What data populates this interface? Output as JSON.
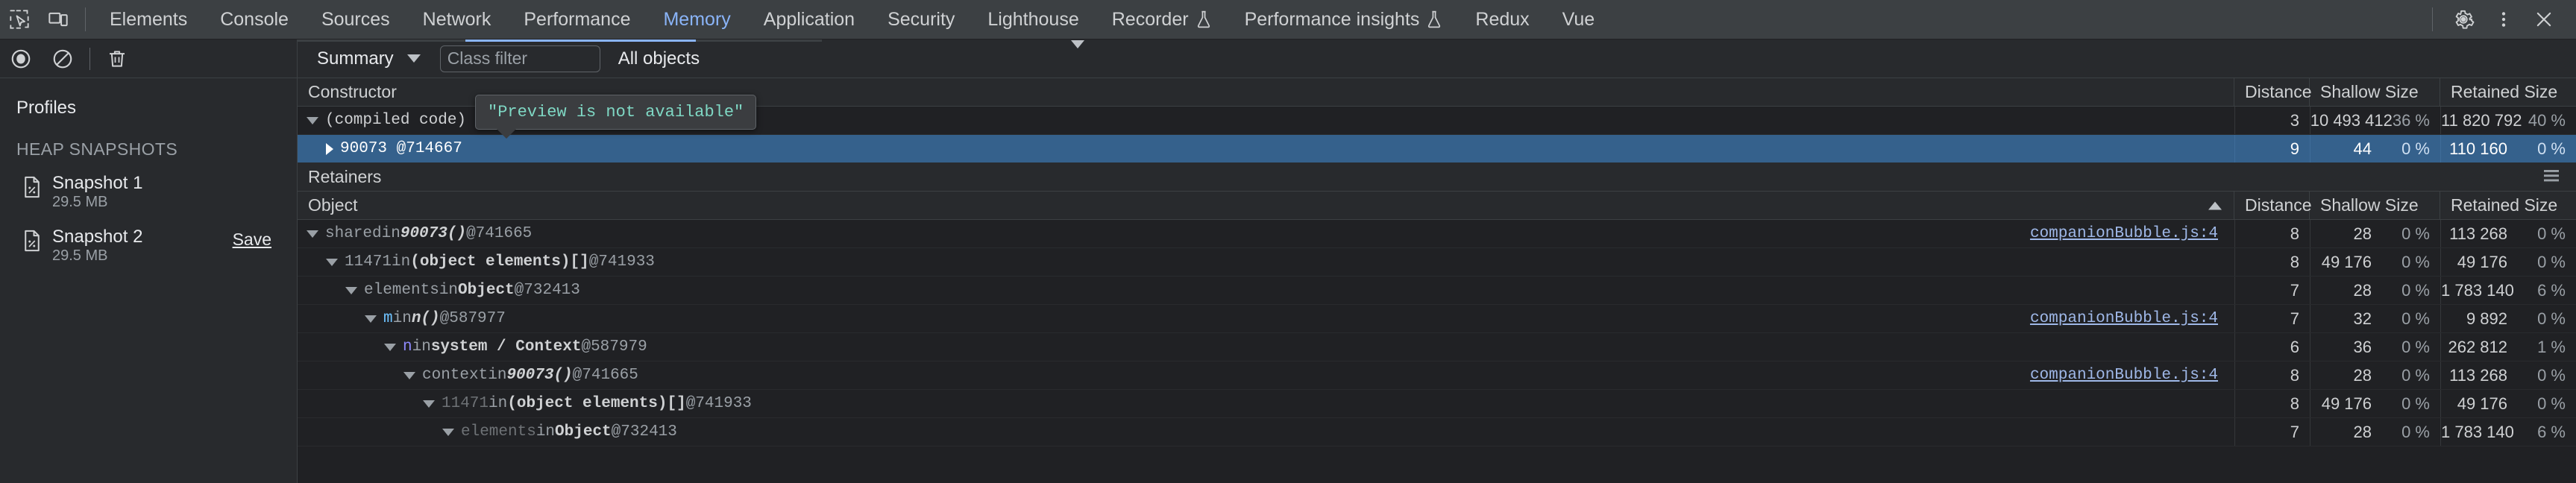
{
  "tabbar": {
    "inspect_icon": "inspect-element-icon",
    "device_icon": "device-toolbar-icon",
    "tabs": [
      {
        "label": "Elements",
        "active": false,
        "experimental": false
      },
      {
        "label": "Console",
        "active": false,
        "experimental": false
      },
      {
        "label": "Sources",
        "active": false,
        "experimental": false
      },
      {
        "label": "Network",
        "active": false,
        "experimental": false
      },
      {
        "label": "Performance",
        "active": false,
        "experimental": false
      },
      {
        "label": "Memory",
        "active": true,
        "experimental": false
      },
      {
        "label": "Application",
        "active": false,
        "experimental": false
      },
      {
        "label": "Security",
        "active": false,
        "experimental": false
      },
      {
        "label": "Lighthouse",
        "active": false,
        "experimental": false
      },
      {
        "label": "Recorder",
        "active": false,
        "experimental": true
      },
      {
        "label": "Performance insights",
        "active": false,
        "experimental": true
      },
      {
        "label": "Redux",
        "active": false,
        "experimental": false
      },
      {
        "label": "Vue",
        "active": false,
        "experimental": false
      }
    ],
    "settings_icon": "gear-icon",
    "more_icon": "more-vertical-icon",
    "close_icon": "close-icon"
  },
  "toolbar": {
    "record_icon": "record-heap-snapshot-icon",
    "clear_icon": "clear-icon",
    "delete_icon": "trash-icon",
    "view_select": "Summary",
    "class_filter_placeholder": "Class filter",
    "class_filter_value": "",
    "objects_select": "All objects"
  },
  "sidebar": {
    "title": "Profiles",
    "section_label": "HEAP SNAPSHOTS",
    "snapshots": [
      {
        "name": "Snapshot 1",
        "size": "29.5 MB",
        "save_label": "",
        "selected": false
      },
      {
        "name": "Snapshot 2",
        "size": "29.5 MB",
        "save_label": "Save",
        "selected": true
      }
    ]
  },
  "constructor_pane": {
    "title": "Constructor",
    "columns": [
      "Constructor",
      "Distance",
      "Shallow Size",
      "Retained Size"
    ],
    "rows": [
      {
        "twisty": "open",
        "indent": 0,
        "label": "(compiled code)",
        "selected": false,
        "distance": "3",
        "shallow": "10 493 412",
        "shallow_pct": "36 %",
        "retained": "11 820 792",
        "retained_pct": "40 %"
      },
      {
        "twisty": "closed",
        "indent": 1,
        "label": "90073 @714667",
        "selected": true,
        "distance": "9",
        "shallow": "44",
        "shallow_pct": "0 %",
        "retained": "110 160",
        "retained_pct": "0 %"
      }
    ]
  },
  "tooltip": {
    "text": "\"Preview is not available\""
  },
  "retainers_pane": {
    "title": "Retainers",
    "menu_icon": "hamburger-menu-icon",
    "columns": [
      "Object",
      "Distance",
      "Shallow Size",
      "Retained Size"
    ],
    "sort_indicator": "sort-ascending-icon",
    "rows": [
      {
        "indent": 0,
        "twisty": "open",
        "prop": "shared",
        "prop_style": "dim",
        "holder": "90073()",
        "holder_style": "fn",
        "id": "@741665",
        "link": "companionBubble.js:4",
        "distance": "8",
        "shallow": "28",
        "shallow_pct": "0 %",
        "retained": "113 268",
        "retained_pct": "0 %"
      },
      {
        "indent": 1,
        "twisty": "open",
        "prop": "11471",
        "prop_style": "dim",
        "holder": "(object elements)[]",
        "holder_style": "cls",
        "id": "@741933",
        "link": "",
        "distance": "8",
        "shallow": "49 176",
        "shallow_pct": "0 %",
        "retained": "49 176",
        "retained_pct": "0 %"
      },
      {
        "indent": 2,
        "twisty": "open",
        "prop": "elements",
        "prop_style": "dim",
        "holder": "Object",
        "holder_style": "cls",
        "id": "@732413",
        "link": "",
        "distance": "7",
        "shallow": "28",
        "shallow_pct": "0 %",
        "retained": "1 783 140",
        "retained_pct": "6 %"
      },
      {
        "indent": 3,
        "twisty": "open",
        "prop": "m",
        "prop_style": "blue",
        "holder": "n()",
        "holder_style": "fn",
        "id": "@587977",
        "link": "companionBubble.js:4",
        "distance": "7",
        "shallow": "32",
        "shallow_pct": "0 %",
        "retained": "9 892",
        "retained_pct": "0 %"
      },
      {
        "indent": 4,
        "twisty": "open",
        "prop": "n",
        "prop_style": "purple",
        "holder": "system / Context",
        "holder_style": "cls",
        "id": "@587979",
        "link": "",
        "distance": "6",
        "shallow": "36",
        "shallow_pct": "0 %",
        "retained": "262 812",
        "retained_pct": "1 %"
      },
      {
        "indent": 5,
        "twisty": "open",
        "prop": "context",
        "prop_style": "dim",
        "holder": "90073()",
        "holder_style": "fn",
        "id": "@741665",
        "link": "companionBubble.js:4",
        "distance": "8",
        "shallow": "28",
        "shallow_pct": "0 %",
        "retained": "113 268",
        "retained_pct": "0 %"
      },
      {
        "indent": 6,
        "twisty": "open",
        "prop": "11471",
        "prop_style": "faded",
        "holder": "(object elements)[]",
        "holder_style": "cls",
        "id": "@741933",
        "link": "",
        "distance": "8",
        "shallow": "49 176",
        "shallow_pct": "0 %",
        "retained": "49 176",
        "retained_pct": "0 %"
      },
      {
        "indent": 7,
        "twisty": "open",
        "prop": "elements",
        "prop_style": "faded",
        "holder": "Object",
        "holder_style": "cls",
        "id": "@732413",
        "link": "",
        "distance": "7",
        "shallow": "28",
        "shallow_pct": "0 %",
        "retained": "1 783 140",
        "retained_pct": "6 %"
      }
    ]
  }
}
